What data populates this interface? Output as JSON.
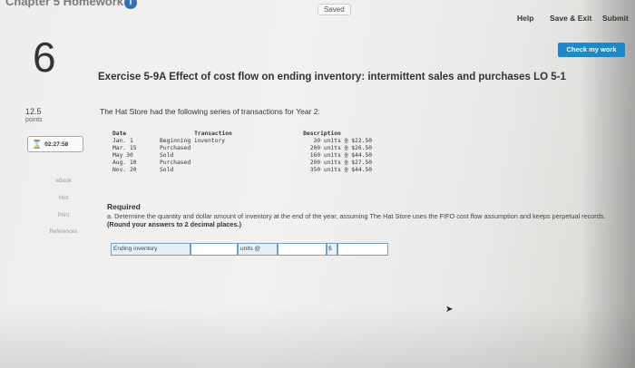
{
  "header": {
    "chapter_title": "Chapter 5 Homework",
    "saved": "Saved",
    "help": "Help",
    "save_exit": "Save & Exit",
    "submit": "Submit",
    "check_my_work": "Check my work"
  },
  "question": {
    "number": "6",
    "points_value": "12.5",
    "points_label": "points",
    "timer": "02:27:58",
    "title": "Exercise 5-9A Effect of cost flow on ending inventory: intermittent sales and purchases LO 5-1"
  },
  "sidebar": {
    "items": [
      "eBook",
      "Hint",
      "Print",
      "References"
    ]
  },
  "body": {
    "intro": "The Hat Store had the following series of transactions for Year 2:",
    "table": {
      "headers": [
        "Date",
        "Transaction",
        "Description"
      ],
      "rows": [
        [
          "Jan.  1",
          "Beginning inventory",
          "30 units @  $22.50"
        ],
        [
          "Mar. 15",
          "Purchased",
          "200 units @  $26.50"
        ],
        [
          "May  30",
          "Sold",
          "160 units @  $44.50"
        ],
        [
          "Aug. 10",
          "Purchased",
          "290 units @  $27.50"
        ],
        [
          "Nov. 20",
          "Sold",
          "350 units @  $44.50"
        ]
      ]
    },
    "required_heading": "Required",
    "required_text": "a. Determine the quantity and dollar amount of inventory at the end of the year, assuming The Hat Store uses the FIFO cost flow assumption and keeps perpetual records.",
    "required_bold": "(Round your answers to 2 decimal places.)"
  },
  "answer": {
    "label": "Ending inventory",
    "units_label": "units @",
    "quantity_value": "",
    "unit_cost_value": "",
    "currency": "$",
    "total_value": ""
  }
}
